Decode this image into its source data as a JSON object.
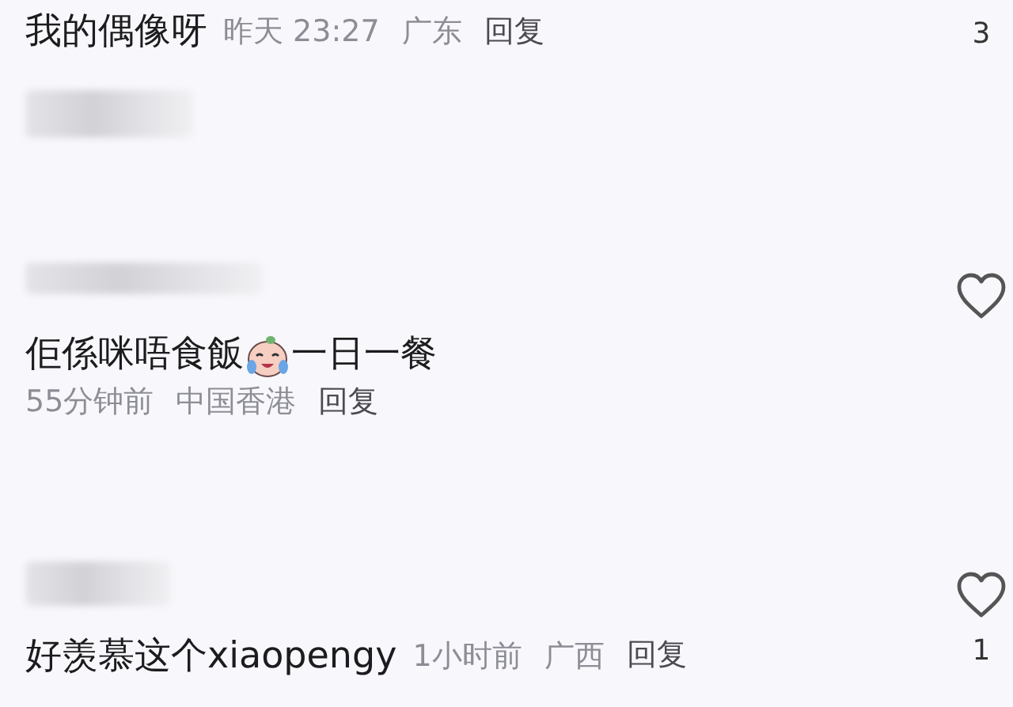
{
  "items": [
    {
      "kind": "comment_inline",
      "author_hidden": false,
      "parts": [
        {
          "kind": "text",
          "text": "我的偶像呀"
        }
      ],
      "time": "昨天 23:27",
      "location": "广东",
      "reply": "回复",
      "heart": false,
      "likes": "3"
    },
    {
      "kind": "blurred"
    },
    {
      "kind": "comment_stacked",
      "author_hidden": true,
      "parts": [
        {
          "kind": "text",
          "text": "佢係咪唔食飯"
        },
        {
          "kind": "emoji"
        },
        {
          "kind": "text",
          "text": "一日一餐"
        }
      ],
      "time": "55分钟前",
      "location": "中国香港",
      "reply": "回复",
      "heart": true
    },
    {
      "kind": "comment_inline",
      "author_hidden": true,
      "parts": [
        {
          "kind": "text",
          "text": "好羡慕这个xiaopengy"
        }
      ],
      "time": "1小时前",
      "location": "广西",
      "reply": "回复",
      "heart": true,
      "likes": "1"
    }
  ]
}
